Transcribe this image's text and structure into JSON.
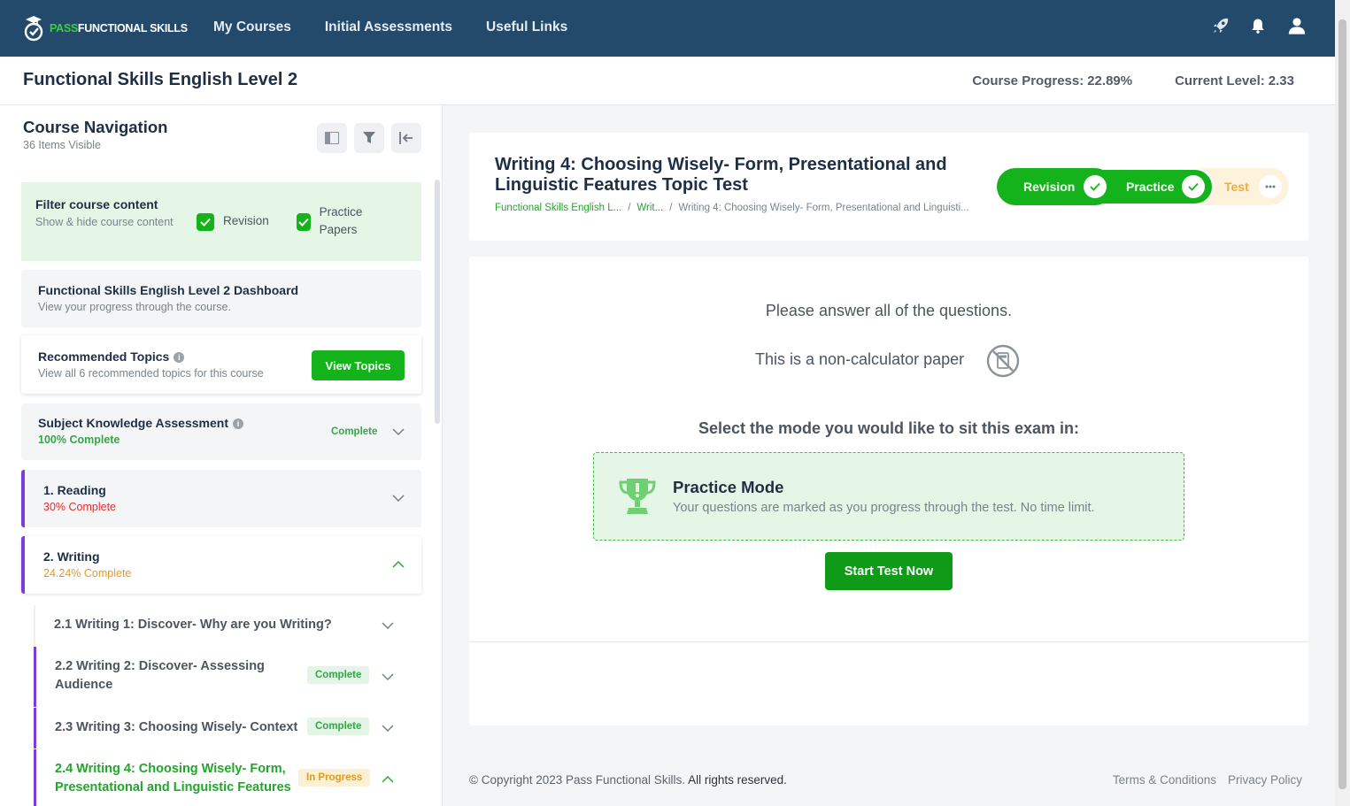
{
  "brand": {
    "logo_green": "PASS",
    "logo_white": "FUNCTIONAL SKILLS",
    "accent": "#15b31b",
    "nav_bg": "#244a6b"
  },
  "nav": {
    "links": [
      "My Courses",
      "Initial Assessments",
      "Useful Links"
    ],
    "icons": [
      "rocket-icon",
      "bell-icon",
      "user-icon"
    ]
  },
  "course": {
    "title": "Functional Skills English Level 2",
    "progress_label": "Course Progress:",
    "progress_value": "22.89%",
    "level_label": "Current Level:",
    "level_value": "2.33"
  },
  "sidebar": {
    "title": "Course Navigation",
    "subtitle": "36 Items Visible",
    "filter": {
      "title": "Filter course content",
      "subtitle": "Show & hide course content",
      "options": [
        "Revision",
        "Practice Papers"
      ]
    },
    "dashboard": {
      "title": "Functional Skills English Level 2 Dashboard",
      "subtitle": "View your progress through the course."
    },
    "recommended": {
      "title": "Recommended Topics",
      "subtitle": "View all 6 recommended topics for this course",
      "button": "View Topics"
    },
    "ska": {
      "title": "Subject Knowledge Assessment",
      "progress": "100% Complete",
      "status": "Complete"
    },
    "reading": {
      "title": "1. Reading",
      "progress": "30% Complete"
    },
    "writing": {
      "title": "2. Writing",
      "progress": "24.24% Complete"
    },
    "topics": [
      {
        "title": "2.1 Writing 1: Discover- Why are you Writing?",
        "status": ""
      },
      {
        "title": "2.2 Writing 2: Discover- Assessing Audience",
        "status": "Complete"
      },
      {
        "title": "2.3 Writing 3: Choosing Wisely- Context",
        "status": "Complete"
      },
      {
        "title": "2.4 Writing 4: Choosing Wisely- Form, Presentational and Linguistic Features",
        "status": "In Progress"
      }
    ]
  },
  "lesson": {
    "title": "Writing 4: Choosing Wisely- Form, Presentational and Linguistic Features Topic Test",
    "breadcrumb": [
      "Functional Skills English L...",
      "Writ...",
      "Writing 4: Choosing Wisely- Form, Presentational and Linguisti..."
    ],
    "modes": [
      "Revision",
      "Practice",
      "Test"
    ]
  },
  "test": {
    "instruction": "Please answer all of the questions.",
    "calculator": "This is a non-calculator paper",
    "select_mode": "Select the mode you would like to sit this exam in:",
    "practice_title": "Practice Mode",
    "practice_desc": "Your questions are marked as you progress through the test. No time limit.",
    "start_button": "Start Test Now"
  },
  "footer": {
    "copyright": "© Copyright 2023 Pass Functional Skills.",
    "rights": "All rights reserved.",
    "links": [
      "Terms & Conditions",
      "Privacy Policy"
    ]
  }
}
